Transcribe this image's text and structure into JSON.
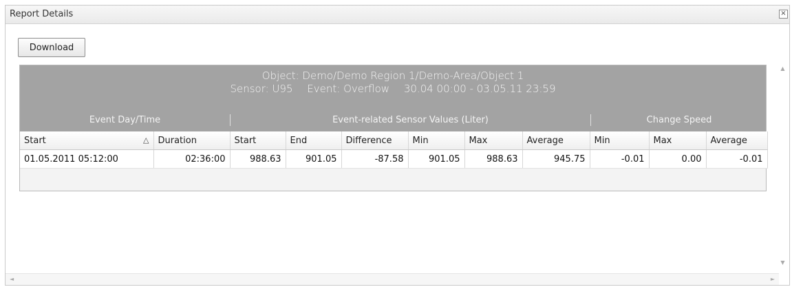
{
  "window": {
    "title": "Report Details",
    "close_label": "×"
  },
  "toolbar": {
    "download_label": "Download"
  },
  "report": {
    "object_line": "Object: Demo/Demo Region 1/Demo-Area/Object 1",
    "sensor": "Sensor: U95",
    "event": "Event: Overflow",
    "period": "30.04 00:00 - 03.05.11 23:59",
    "groups": {
      "event_day_time": "Event Day/Time",
      "sensor_values": "Event-related Sensor Values (Liter)",
      "change_speed": "Change Speed"
    },
    "columns": [
      "Start",
      "Duration",
      "Start",
      "End",
      "Difference",
      "Min",
      "Max",
      "Average",
      "Min",
      "Max",
      "Average"
    ],
    "sort_icon": "△",
    "rows": [
      [
        "01.05.2011 05:12:00",
        "02:36:00",
        "988.63",
        "901.05",
        "-87.58",
        "901.05",
        "988.63",
        "945.75",
        "-0.01",
        "0.00",
        "-0.01"
      ]
    ]
  },
  "scrollbars": {
    "up": "▲",
    "down": "▼",
    "left": "◄",
    "right": "►"
  },
  "colors": {
    "header_bg": "#a3a3a3",
    "header_text": "#f4f4f4"
  }
}
